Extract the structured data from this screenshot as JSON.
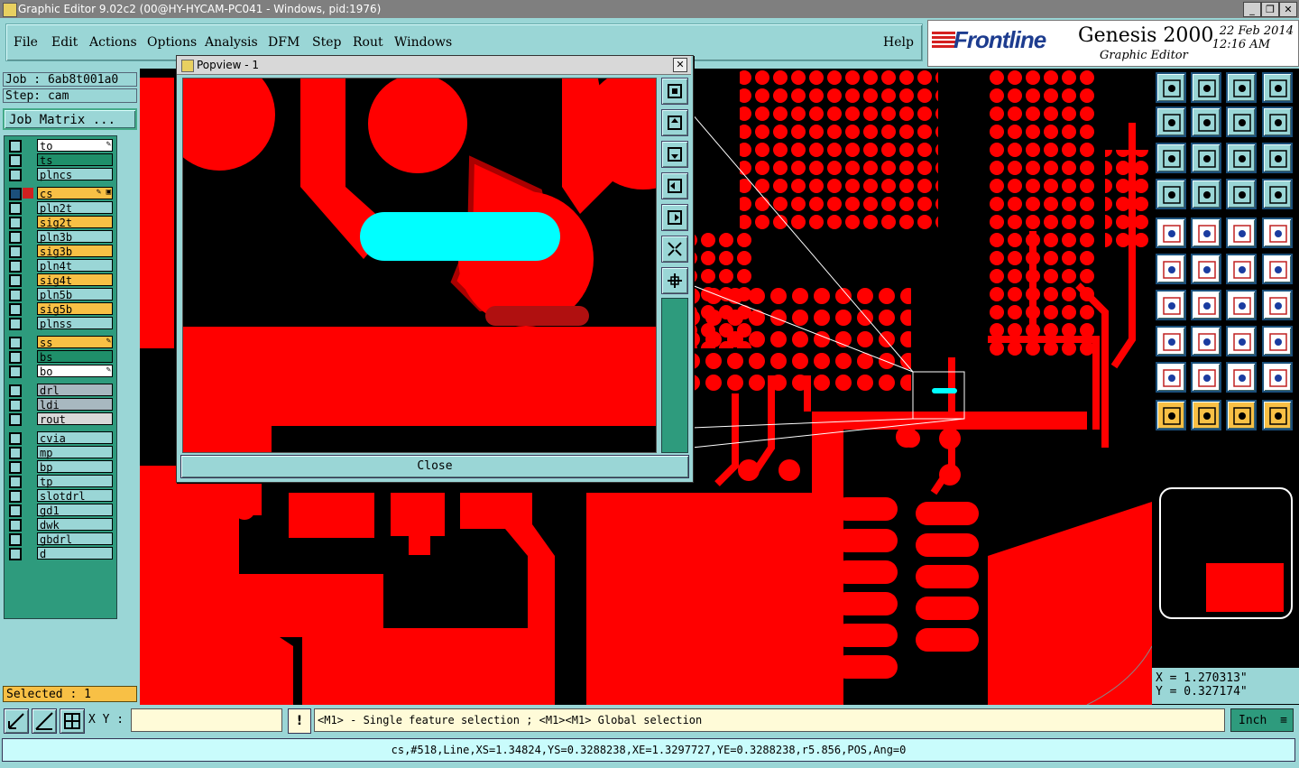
{
  "window": {
    "title": "Graphic Editor 9.02c2 (00@HY-HYCAM-PC041 - Windows, pid:1976)"
  },
  "menu": {
    "items": [
      "File",
      "Edit",
      "Actions",
      "Options",
      "Analysis",
      "DFM",
      "Step",
      "Rout",
      "Windows"
    ],
    "help": "Help"
  },
  "brand": {
    "logo": "Frontline",
    "product": "Genesis 2000",
    "subtitle": "Graphic Editor",
    "date": "22 Feb 2014",
    "time": "12:16 AM"
  },
  "job": {
    "job_label": "Job : 6ab8t001a0",
    "step_label": "Step: cam",
    "matrix_button": "Job Matrix ..."
  },
  "layers": [
    {
      "name": "to",
      "color": "#ffffff",
      "flag": "✎"
    },
    {
      "name": "ts",
      "color": "#1f8f6a",
      "flag": ""
    },
    {
      "name": "plncs",
      "color": "#9ad6d6",
      "flag": ""
    },
    {
      "name": "cs",
      "color": "#f8c045",
      "flag": "✎ ▣",
      "active": true
    },
    {
      "name": "pln2t",
      "color": "#9ad6d6",
      "flag": ""
    },
    {
      "name": "sig2t",
      "color": "#f8c045",
      "flag": ""
    },
    {
      "name": "pln3b",
      "color": "#9ad6d6",
      "flag": ""
    },
    {
      "name": "sig3b",
      "color": "#f8c045",
      "flag": ""
    },
    {
      "name": "pln4t",
      "color": "#9ad6d6",
      "flag": ""
    },
    {
      "name": "sig4t",
      "color": "#f8c045",
      "flag": ""
    },
    {
      "name": "pln5b",
      "color": "#9ad6d6",
      "flag": ""
    },
    {
      "name": "sig5b",
      "color": "#f8c045",
      "flag": ""
    },
    {
      "name": "plnss",
      "color": "#9ad6d6",
      "flag": ""
    },
    {
      "name": "ss",
      "color": "#f8c045",
      "flag": "✎"
    },
    {
      "name": "bs",
      "color": "#1f8f6a",
      "flag": ""
    },
    {
      "name": "bo",
      "color": "#ffffff",
      "flag": "✎"
    },
    {
      "name": "drl",
      "color": "#a8b8c0",
      "flag": ""
    },
    {
      "name": "ldi",
      "color": "#a8b8c0",
      "flag": ""
    },
    {
      "name": "rout",
      "color": "#d8d8d8",
      "flag": ""
    },
    {
      "name": "cvia",
      "color": "#9ad6d6",
      "flag": ""
    },
    {
      "name": "mp",
      "color": "#9ad6d6",
      "flag": ""
    },
    {
      "name": "bp",
      "color": "#9ad6d6",
      "flag": ""
    },
    {
      "name": "tp",
      "color": "#9ad6d6",
      "flag": ""
    },
    {
      "name": "slotdrl",
      "color": "#9ad6d6",
      "flag": ""
    },
    {
      "name": "gd1",
      "color": "#9ad6d6",
      "flag": ""
    },
    {
      "name": "dwk",
      "color": "#9ad6d6",
      "flag": ""
    },
    {
      "name": "gbdrl",
      "color": "#9ad6d6",
      "flag": ""
    },
    {
      "name": "d",
      "color": "#9ad6d6",
      "flag": ""
    }
  ],
  "selected": "Selected : 1",
  "popview": {
    "title": "Popview - 1",
    "close": "Close"
  },
  "coords": {
    "x": "X =  1.270313\"",
    "y": "Y =  0.327174\""
  },
  "status": {
    "xy_label": "X Y :",
    "xy_value": "",
    "warn": "!",
    "message": "<M1> - Single feature selection ; <M1><M1> Global selection",
    "units": "Inch"
  },
  "info": "cs,#518,Line,XS=1.34824,YS=0.3288238,XE=1.3297727,YE=0.3288238,r5.856,POS,Ang=0",
  "colors": {
    "copper": "#ff0000",
    "highlight": "#00ffff",
    "panel": "#9ad6d6"
  }
}
